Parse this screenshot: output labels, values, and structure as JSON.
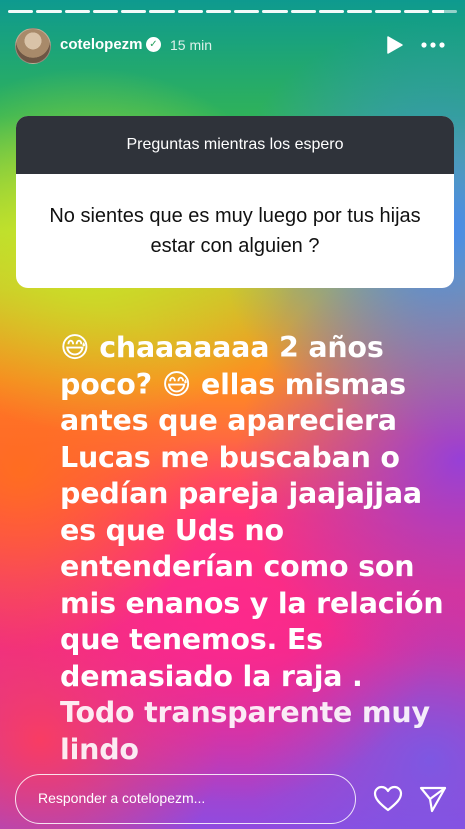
{
  "story": {
    "progress": {
      "total_segments": 16,
      "completed_segments": 15,
      "current_fraction": 0.5
    },
    "header": {
      "username": "cotelopezm",
      "verified": true,
      "time_ago": "15 min"
    },
    "question_card": {
      "prompt": "Preguntas mientras los espero",
      "question": "No sientes que es muy luego por tus hijas estar con alguien ?"
    },
    "answer_lines": [
      "😅 chaaaaaaa 2 años",
      "poco? 😅 ellas mismas",
      "antes que apareciera",
      "Lucas me buscaban o",
      "pedían pareja jaajajjaa",
      "es que Uds no",
      "entenderían como son",
      "mis enanos y la relación",
      "que tenemos. Es",
      "demasiado la raja .",
      "Todo transparente muy",
      "lindo"
    ],
    "footer": {
      "reply_placeholder": "Responder a cotelopezm..."
    },
    "icons": {
      "play": "play-icon",
      "more": "more-options-icon",
      "like": "heart-icon",
      "share": "send-icon"
    }
  }
}
